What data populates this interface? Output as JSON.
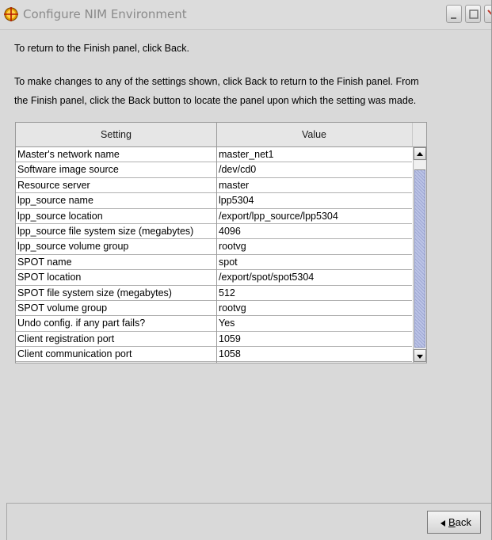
{
  "window": {
    "title": "Configure NIM Environment"
  },
  "instructions": {
    "line1": "To return to the Finish panel, click Back.",
    "line2": "To make changes to any of the settings shown, click Back to return to the Finish panel.  From",
    "line3": "the Finish panel, click the Back button to locate the panel upon which the setting was made."
  },
  "table": {
    "columns": [
      "Setting",
      "Value"
    ],
    "rows": [
      {
        "setting": "Master's network name",
        "value": "master_net1"
      },
      {
        "setting": "Software image source",
        "value": "/dev/cd0"
      },
      {
        "setting": "Resource server",
        "value": "master"
      },
      {
        "setting": "lpp_source name",
        "value": "lpp5304"
      },
      {
        "setting": "lpp_source location",
        "value": "/export/lpp_source/lpp5304"
      },
      {
        "setting": "lpp_source file system size (megabytes)",
        "value": "4096"
      },
      {
        "setting": "lpp_source volume group",
        "value": "rootvg"
      },
      {
        "setting": "SPOT name",
        "value": "spot"
      },
      {
        "setting": "SPOT location",
        "value": "/export/spot/spot5304"
      },
      {
        "setting": "SPOT file system size (megabytes)",
        "value": "512"
      },
      {
        "setting": "SPOT volume group",
        "value": "rootvg"
      },
      {
        "setting": "Undo config. if any part fails?",
        "value": "Yes"
      },
      {
        "setting": "Client registration port",
        "value": "1059"
      },
      {
        "setting": "Client communication port",
        "value": "1058"
      }
    ]
  },
  "footer": {
    "back_label_mnemonic": "B",
    "back_label_rest": "ack"
  },
  "icons": {
    "app": "nim-app-icon",
    "minimize": "minimize-icon",
    "maximize": "maximize-icon",
    "close": "close-icon",
    "back_arrow": "arrow-left-icon"
  }
}
